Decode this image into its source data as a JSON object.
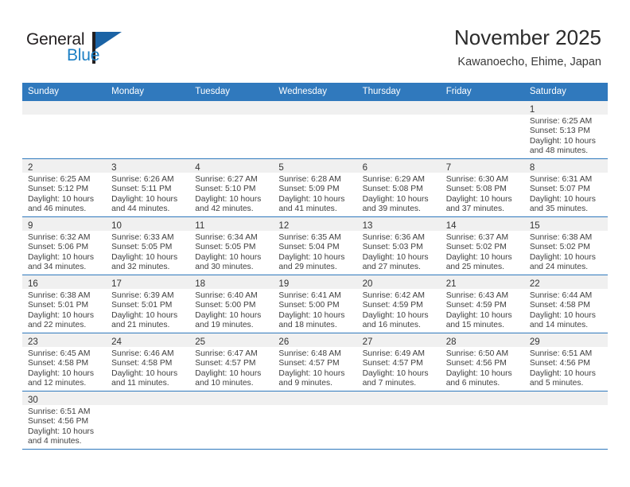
{
  "brand": {
    "name_part1": "General",
    "name_part2": "Blue",
    "accent_color": "#1c7fc4",
    "triangle_color": "#1b63a5"
  },
  "header": {
    "title": "November 2025",
    "subtitle": "Kawanoecho, Ehime, Japan"
  },
  "theme": {
    "header_row_color": "#3079bd",
    "daynum_strip_color": "#f0f0f0",
    "grid_line_color": "#3079bd"
  },
  "weekday_headers": [
    "Sunday",
    "Monday",
    "Tuesday",
    "Wednesday",
    "Thursday",
    "Friday",
    "Saturday"
  ],
  "weeks": [
    [
      {
        "empty": true
      },
      {
        "empty": true
      },
      {
        "empty": true
      },
      {
        "empty": true
      },
      {
        "empty": true
      },
      {
        "empty": true
      },
      {
        "day": "1",
        "sunrise": "Sunrise: 6:25 AM",
        "sunset": "Sunset: 5:13 PM",
        "daylight_line1": "Daylight: 10 hours",
        "daylight_line2": "and 48 minutes."
      }
    ],
    [
      {
        "day": "2",
        "sunrise": "Sunrise: 6:25 AM",
        "sunset": "Sunset: 5:12 PM",
        "daylight_line1": "Daylight: 10 hours",
        "daylight_line2": "and 46 minutes."
      },
      {
        "day": "3",
        "sunrise": "Sunrise: 6:26 AM",
        "sunset": "Sunset: 5:11 PM",
        "daylight_line1": "Daylight: 10 hours",
        "daylight_line2": "and 44 minutes."
      },
      {
        "day": "4",
        "sunrise": "Sunrise: 6:27 AM",
        "sunset": "Sunset: 5:10 PM",
        "daylight_line1": "Daylight: 10 hours",
        "daylight_line2": "and 42 minutes."
      },
      {
        "day": "5",
        "sunrise": "Sunrise: 6:28 AM",
        "sunset": "Sunset: 5:09 PM",
        "daylight_line1": "Daylight: 10 hours",
        "daylight_line2": "and 41 minutes."
      },
      {
        "day": "6",
        "sunrise": "Sunrise: 6:29 AM",
        "sunset": "Sunset: 5:08 PM",
        "daylight_line1": "Daylight: 10 hours",
        "daylight_line2": "and 39 minutes."
      },
      {
        "day": "7",
        "sunrise": "Sunrise: 6:30 AM",
        "sunset": "Sunset: 5:08 PM",
        "daylight_line1": "Daylight: 10 hours",
        "daylight_line2": "and 37 minutes."
      },
      {
        "day": "8",
        "sunrise": "Sunrise: 6:31 AM",
        "sunset": "Sunset: 5:07 PM",
        "daylight_line1": "Daylight: 10 hours",
        "daylight_line2": "and 35 minutes."
      }
    ],
    [
      {
        "day": "9",
        "sunrise": "Sunrise: 6:32 AM",
        "sunset": "Sunset: 5:06 PM",
        "daylight_line1": "Daylight: 10 hours",
        "daylight_line2": "and 34 minutes."
      },
      {
        "day": "10",
        "sunrise": "Sunrise: 6:33 AM",
        "sunset": "Sunset: 5:05 PM",
        "daylight_line1": "Daylight: 10 hours",
        "daylight_line2": "and 32 minutes."
      },
      {
        "day": "11",
        "sunrise": "Sunrise: 6:34 AM",
        "sunset": "Sunset: 5:05 PM",
        "daylight_line1": "Daylight: 10 hours",
        "daylight_line2": "and 30 minutes."
      },
      {
        "day": "12",
        "sunrise": "Sunrise: 6:35 AM",
        "sunset": "Sunset: 5:04 PM",
        "daylight_line1": "Daylight: 10 hours",
        "daylight_line2": "and 29 minutes."
      },
      {
        "day": "13",
        "sunrise": "Sunrise: 6:36 AM",
        "sunset": "Sunset: 5:03 PM",
        "daylight_line1": "Daylight: 10 hours",
        "daylight_line2": "and 27 minutes."
      },
      {
        "day": "14",
        "sunrise": "Sunrise: 6:37 AM",
        "sunset": "Sunset: 5:02 PM",
        "daylight_line1": "Daylight: 10 hours",
        "daylight_line2": "and 25 minutes."
      },
      {
        "day": "15",
        "sunrise": "Sunrise: 6:38 AM",
        "sunset": "Sunset: 5:02 PM",
        "daylight_line1": "Daylight: 10 hours",
        "daylight_line2": "and 24 minutes."
      }
    ],
    [
      {
        "day": "16",
        "sunrise": "Sunrise: 6:38 AM",
        "sunset": "Sunset: 5:01 PM",
        "daylight_line1": "Daylight: 10 hours",
        "daylight_line2": "and 22 minutes."
      },
      {
        "day": "17",
        "sunrise": "Sunrise: 6:39 AM",
        "sunset": "Sunset: 5:01 PM",
        "daylight_line1": "Daylight: 10 hours",
        "daylight_line2": "and 21 minutes."
      },
      {
        "day": "18",
        "sunrise": "Sunrise: 6:40 AM",
        "sunset": "Sunset: 5:00 PM",
        "daylight_line1": "Daylight: 10 hours",
        "daylight_line2": "and 19 minutes."
      },
      {
        "day": "19",
        "sunrise": "Sunrise: 6:41 AM",
        "sunset": "Sunset: 5:00 PM",
        "daylight_line1": "Daylight: 10 hours",
        "daylight_line2": "and 18 minutes."
      },
      {
        "day": "20",
        "sunrise": "Sunrise: 6:42 AM",
        "sunset": "Sunset: 4:59 PM",
        "daylight_line1": "Daylight: 10 hours",
        "daylight_line2": "and 16 minutes."
      },
      {
        "day": "21",
        "sunrise": "Sunrise: 6:43 AM",
        "sunset": "Sunset: 4:59 PM",
        "daylight_line1": "Daylight: 10 hours",
        "daylight_line2": "and 15 minutes."
      },
      {
        "day": "22",
        "sunrise": "Sunrise: 6:44 AM",
        "sunset": "Sunset: 4:58 PM",
        "daylight_line1": "Daylight: 10 hours",
        "daylight_line2": "and 14 minutes."
      }
    ],
    [
      {
        "day": "23",
        "sunrise": "Sunrise: 6:45 AM",
        "sunset": "Sunset: 4:58 PM",
        "daylight_line1": "Daylight: 10 hours",
        "daylight_line2": "and 12 minutes."
      },
      {
        "day": "24",
        "sunrise": "Sunrise: 6:46 AM",
        "sunset": "Sunset: 4:58 PM",
        "daylight_line1": "Daylight: 10 hours",
        "daylight_line2": "and 11 minutes."
      },
      {
        "day": "25",
        "sunrise": "Sunrise: 6:47 AM",
        "sunset": "Sunset: 4:57 PM",
        "daylight_line1": "Daylight: 10 hours",
        "daylight_line2": "and 10 minutes."
      },
      {
        "day": "26",
        "sunrise": "Sunrise: 6:48 AM",
        "sunset": "Sunset: 4:57 PM",
        "daylight_line1": "Daylight: 10 hours",
        "daylight_line2": "and 9 minutes."
      },
      {
        "day": "27",
        "sunrise": "Sunrise: 6:49 AM",
        "sunset": "Sunset: 4:57 PM",
        "daylight_line1": "Daylight: 10 hours",
        "daylight_line2": "and 7 minutes."
      },
      {
        "day": "28",
        "sunrise": "Sunrise: 6:50 AM",
        "sunset": "Sunset: 4:56 PM",
        "daylight_line1": "Daylight: 10 hours",
        "daylight_line2": "and 6 minutes."
      },
      {
        "day": "29",
        "sunrise": "Sunrise: 6:51 AM",
        "sunset": "Sunset: 4:56 PM",
        "daylight_line1": "Daylight: 10 hours",
        "daylight_line2": "and 5 minutes."
      }
    ],
    [
      {
        "day": "30",
        "sunrise": "Sunrise: 6:51 AM",
        "sunset": "Sunset: 4:56 PM",
        "daylight_line1": "Daylight: 10 hours",
        "daylight_line2": "and 4 minutes."
      },
      {
        "empty": true
      },
      {
        "empty": true
      },
      {
        "empty": true
      },
      {
        "empty": true
      },
      {
        "empty": true
      },
      {
        "empty": true
      }
    ]
  ]
}
